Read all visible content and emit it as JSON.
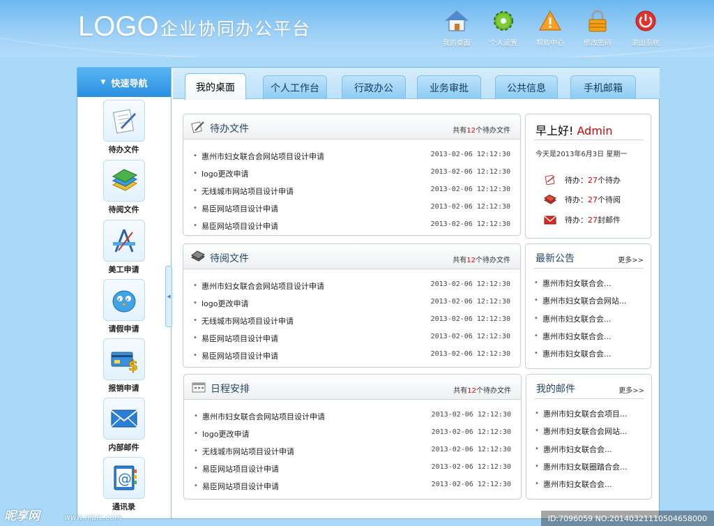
{
  "header": {
    "logo": "LOGO",
    "platform_title": "企业协同办公平台",
    "nav": [
      {
        "label": "我的桌面",
        "icon": "house-icon"
      },
      {
        "label": "个人设置",
        "icon": "gear-icon"
      },
      {
        "label": "帮助中心",
        "icon": "warning-icon"
      },
      {
        "label": "修改密码",
        "icon": "lock-icon"
      },
      {
        "label": "退出系统",
        "icon": "power-icon"
      }
    ]
  },
  "sidebar": {
    "title": "快速导航",
    "items": [
      {
        "label": "待办文件",
        "icon": "document-pen-icon"
      },
      {
        "label": "待阅文件",
        "icon": "books-icon"
      },
      {
        "label": "美工申请",
        "icon": "design-tool-icon"
      },
      {
        "label": "请假申请",
        "icon": "bird-icon"
      },
      {
        "label": "报销申请",
        "icon": "credit-card-dollar-icon"
      },
      {
        "label": "内部邮件",
        "icon": "envelope-icon"
      },
      {
        "label": "通讯录",
        "icon": "address-book-icon"
      }
    ]
  },
  "tabs": [
    {
      "label": "我的桌面",
      "active": true
    },
    {
      "label": "个人工作台",
      "active": false
    },
    {
      "label": "行政办公",
      "active": false
    },
    {
      "label": "业务审批",
      "active": false
    },
    {
      "label": "公共信息",
      "active": false
    },
    {
      "label": "手机邮箱",
      "active": false
    }
  ],
  "panels": [
    {
      "title": "待办文件",
      "icon": "document-pen-icon",
      "count_prefix": "共有",
      "count": "12",
      "count_suffix": "个待办文件",
      "rows": [
        {
          "title": "惠州市妇女联合会网站项目设计申请",
          "date": "2013-02-06 12:12:30"
        },
        {
          "title": "logo更改申请",
          "date": "2013-02-06 12:12:30"
        },
        {
          "title": "无线城市网站项目设计申请",
          "date": "2013-02-06 12:12:30"
        },
        {
          "title": "易臣网站项目设计申请",
          "date": "2013-02-06 12:12:30"
        },
        {
          "title": "易臣网站项目设计申请",
          "date": "2013-02-06 12:12:30"
        }
      ]
    },
    {
      "title": "待阅文件",
      "icon": "book-icon",
      "count_prefix": "共有",
      "count": "12",
      "count_suffix": "个待办文件",
      "rows": [
        {
          "title": "惠州市妇女联合会网站项目设计申请",
          "date": "2013-02-06 12:12:30"
        },
        {
          "title": "logo更改申请",
          "date": "2013-02-06 12:12:30"
        },
        {
          "title": "无线城市网站项目设计申请",
          "date": "2013-02-06 12:12:30"
        },
        {
          "title": "易臣网站项目设计申请",
          "date": "2013-02-06 12:12:30"
        },
        {
          "title": "易臣网站项目设计申请",
          "date": "2013-02-06 12:12:30"
        }
      ]
    },
    {
      "title": "日程安排",
      "icon": "calendar-icon",
      "count_prefix": "共有",
      "count": "12",
      "count_suffix": "个待办文件",
      "rows": [
        {
          "title": "惠州市妇女联合会网站项目设计申请",
          "date": "2013-02-06 12:12:30"
        },
        {
          "title": "logo更改申请",
          "date": "2013-02-06 12:12:30"
        },
        {
          "title": "无线城市网站项目设计申请",
          "date": "2013-02-06 12:12:30"
        },
        {
          "title": "易臣网站项目设计申请",
          "date": "2013-02-06 12:12:30"
        },
        {
          "title": "易臣网站项目设计申请",
          "date": "2013-02-06 12:12:30"
        }
      ]
    }
  ],
  "welcome": {
    "greeting": "早上好!",
    "user": "Admin",
    "today": "今天是2013年6月3日   星期一",
    "todos": [
      {
        "prefix": "待办：",
        "num": "27",
        "suffix": "个待办",
        "icon": "document-icon"
      },
      {
        "prefix": "待办：",
        "num": "27",
        "suffix": "个待阅",
        "icon": "book-icon"
      },
      {
        "prefix": "待办：",
        "num": "27",
        "suffix": "封邮件",
        "icon": "mail-icon"
      }
    ]
  },
  "notices": {
    "title": "最新公告",
    "more": "更多>>",
    "items": [
      "惠州市妇女联合会...",
      "惠州市妇女联合会网站...",
      "惠州市妇女联合会...",
      "惠州市妇女联合会...",
      "惠州市妇女联合会..."
    ]
  },
  "mails": {
    "title": "我的邮件",
    "more": "更多>>",
    "items": [
      "惠州市妇女联合会项目...",
      "惠州市妇女联合会网站...",
      "惠州市妇女联合会...",
      "惠州市妇女联圈踏合会...",
      "惠州市妇女联合会..."
    ]
  },
  "watermark": {
    "site": "昵享网",
    "url": "www.nipic.com",
    "id": "ID:7096059 NO:20140321110504658000"
  }
}
